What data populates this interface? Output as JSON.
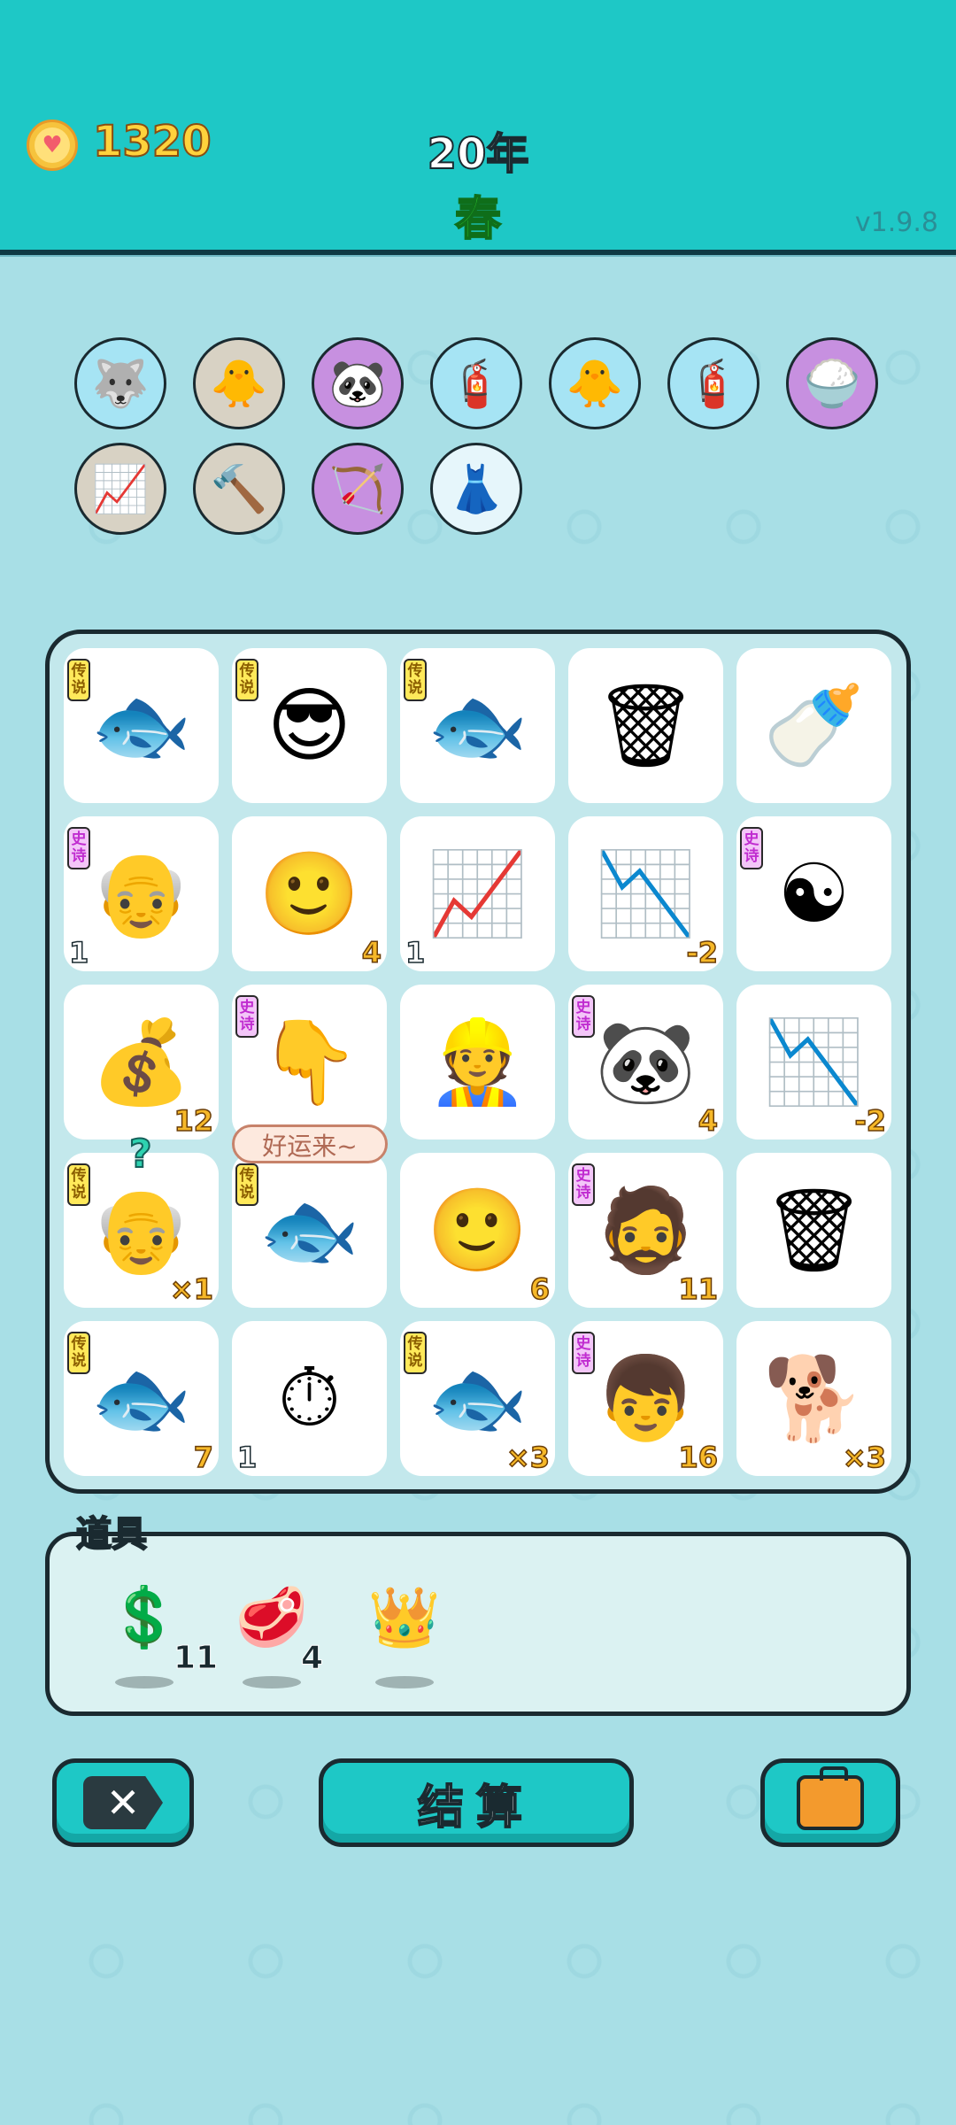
{
  "header": {
    "coins": "1320",
    "year": "20年",
    "season": "春",
    "version": "v1.9.8"
  },
  "inventory": [
    {
      "name": "husky-coin-icon",
      "glyph": "🐺",
      "bg": "blue"
    },
    {
      "name": "hen-egg-icon",
      "glyph": "🐥",
      "bg": "beige"
    },
    {
      "name": "panda-icon",
      "glyph": "🐼",
      "bg": "purple"
    },
    {
      "name": "pump-icon",
      "glyph": "🧯",
      "bg": "blue"
    },
    {
      "name": "hen-egg-icon",
      "glyph": "🐥",
      "bg": "blue"
    },
    {
      "name": "pump-icon",
      "glyph": "🧯",
      "bg": "blue"
    },
    {
      "name": "rice-bowl-icon",
      "glyph": "🍚",
      "bg": "purple"
    },
    {
      "name": "rising-arrow-icon",
      "glyph": "📈",
      "bg": "beige"
    },
    {
      "name": "hammer-icon",
      "glyph": "🔨",
      "bg": "beige"
    },
    {
      "name": "slingshot-icon",
      "glyph": "🏹",
      "bg": "purple"
    },
    {
      "name": "skirt-icon",
      "glyph": "👗",
      "bg": "light"
    }
  ],
  "board": [
    [
      {
        "name": "koi-fish-icon",
        "glyph": "🐟",
        "tag": "legend",
        "tag_text": "传说"
      },
      {
        "name": "sunglasses-man-icon",
        "glyph": "😎",
        "tag": "legend",
        "tag_text": "传说"
      },
      {
        "name": "koi-fish-icon",
        "glyph": "🐟",
        "tag": "legend",
        "tag_text": "传说"
      },
      {
        "name": "garbage-bag-icon",
        "glyph": "🗑"
      },
      {
        "name": "milk-bottle-icon",
        "glyph": "🍼"
      }
    ],
    [
      {
        "name": "old-man-glasses-icon",
        "glyph": "👴",
        "tag": "epic",
        "tag_text": "史诗",
        "left": "1"
      },
      {
        "name": "man-face-icon",
        "glyph": "🙂",
        "right": "4"
      },
      {
        "name": "trend-up-card-icon",
        "glyph": "📈",
        "left": "1"
      },
      {
        "name": "trend-down-chart-icon",
        "glyph": "📉",
        "right": "-2"
      },
      {
        "name": "bagua-icon",
        "glyph": "☯",
        "tag": "epic",
        "tag_text": "史诗"
      }
    ],
    [
      {
        "name": "gold-coins-bank-icon",
        "glyph": "💰",
        "right": "12"
      },
      {
        "name": "pointing-hand-icon",
        "glyph": "👇",
        "tag": "epic",
        "tag_text": "史诗"
      },
      {
        "name": "worker-cap-man-icon",
        "glyph": "👷"
      },
      {
        "name": "panda-icon",
        "glyph": "🐼",
        "tag": "epic",
        "tag_text": "史诗",
        "right": "4"
      },
      {
        "name": "trend-down-chart-icon",
        "glyph": "📉",
        "right": "-2"
      }
    ],
    [
      {
        "name": "bald-grandpa-icon",
        "glyph": "👴",
        "tag": "legend",
        "tag_text": "传说",
        "right": "×1"
      },
      {
        "name": "koi-fish-icon",
        "glyph": "🐟",
        "tag": "legend",
        "tag_text": "传说"
      },
      {
        "name": "man-face-icon",
        "glyph": "🙂",
        "right": "6"
      },
      {
        "name": "green-hat-man-icon",
        "glyph": "🧔",
        "tag": "epic",
        "tag_text": "史诗",
        "right": "11"
      },
      {
        "name": "garbage-bag-icon",
        "glyph": "🗑"
      }
    ],
    [
      {
        "name": "koi-fish-icon",
        "glyph": "🐟",
        "tag": "legend",
        "tag_text": "传说",
        "right": "7"
      },
      {
        "name": "stopwatch-card-icon",
        "glyph": "⏱",
        "left": "1"
      },
      {
        "name": "koi-fish-icon",
        "glyph": "🐟",
        "tag": "legend",
        "tag_text": "传说",
        "right": "×3"
      },
      {
        "name": "red-hat-boy-icon",
        "glyph": "👦",
        "tag": "epic",
        "tag_text": "史诗",
        "right": "16"
      },
      {
        "name": "husky-dog-icon",
        "glyph": "🐕",
        "right": "×3"
      }
    ]
  ],
  "speech_bubble": "好运来~",
  "question_mark": "?",
  "props": {
    "title": "道具",
    "items": [
      {
        "name": "dollar-coin-icon",
        "glyph": "💲",
        "count": "11"
      },
      {
        "name": "liver-icon",
        "glyph": "🥩",
        "count": "4"
      },
      {
        "name": "crown-icon",
        "glyph": "👑",
        "count": ""
      }
    ]
  },
  "buttons": {
    "settle_label": "结算"
  }
}
